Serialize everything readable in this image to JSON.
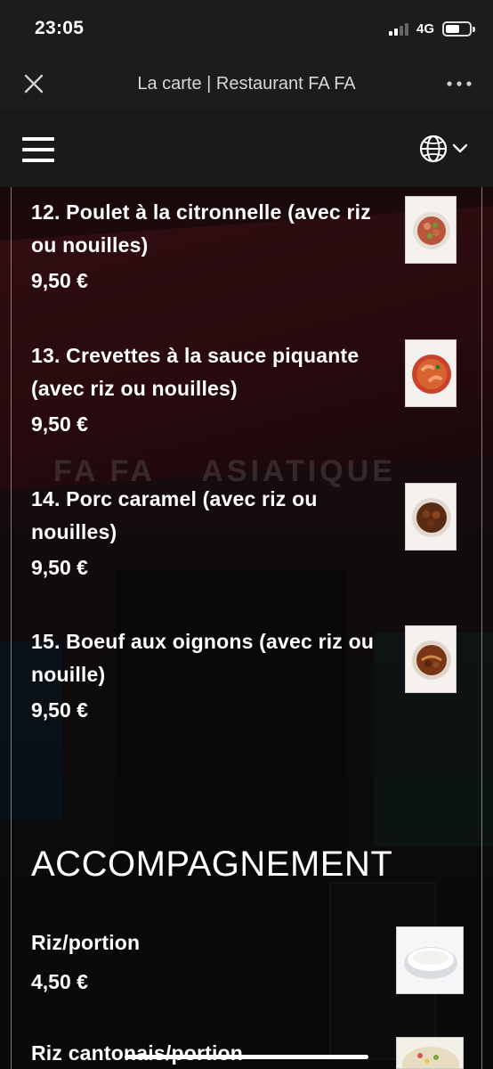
{
  "status_bar": {
    "time": "23:05",
    "network": "4G"
  },
  "browser": {
    "title": "La carte | Restaurant FA FA"
  },
  "menu": {
    "items": [
      {
        "name": "12. Poulet à la citronnelle (avec riz ou nouilles)",
        "price": "9,50 €",
        "image": "lemongrass-chicken-photo"
      },
      {
        "name": "13. Crevettes à la sauce piquante (avec riz ou nouilles)",
        "price": "9,50 €",
        "image": "spicy-shrimp-photo"
      },
      {
        "name": "14. Porc caramel (avec riz ou nouilles)",
        "price": "9,50 €",
        "image": "caramel-pork-photo"
      },
      {
        "name": "15. Boeuf aux oignons (avec riz ou nouille)",
        "price": "9,50 €",
        "image": "beef-onion-photo"
      }
    ],
    "section_title": "ACCOMPAGNEMENT",
    "sides": [
      {
        "name": "Riz/portion",
        "price": "4,50 €",
        "image": "rice-bowl-photo"
      },
      {
        "name": "Riz cantonais/portion",
        "image": "fried-rice-photo"
      }
    ]
  },
  "colors": {
    "status_bg": "#1c1c1c",
    "navbar_bg": "#1a1a1a",
    "text": "#ffffff"
  }
}
